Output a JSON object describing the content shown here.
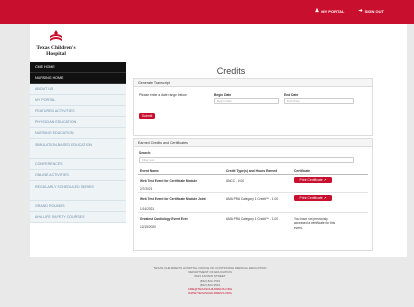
{
  "topbar": {
    "portal": "MY PORTAL",
    "signout": "SIGN OUT"
  },
  "logo": {
    "line1": "Texas Children's",
    "line2": "Hospital"
  },
  "sidebar": {
    "items": [
      {
        "label": "CME HOME",
        "style": "black"
      },
      {
        "label": "NURSING HOME",
        "style": "black"
      },
      {
        "label": "ABOUT US"
      },
      {
        "label": "MY PORTAL"
      },
      {
        "label": "FEATURED ACTIVITIES"
      },
      {
        "label": "PHYSICIAN EDUCATION"
      },
      {
        "label": "NURSING EDUCATION"
      },
      {
        "label": "SIMULATION-BASED EDUCATION",
        "style": "tall"
      },
      {
        "label": "CONFERENCES"
      },
      {
        "label": "ONLINE ACTIVITIES"
      },
      {
        "label": "REGULARLY SCHEDULED SERIES",
        "style": "tall"
      },
      {
        "label": "GRAND ROUNDS"
      },
      {
        "label": "AHA LIFE SAFETY COURSES"
      }
    ]
  },
  "main": {
    "title": "Credits",
    "generate": {
      "header": "Generate Transcript",
      "instructions": "Please enter a date range below:",
      "begin_label": "Begin Date",
      "begin_placeholder": "Begin Date",
      "end_label": "End Date",
      "end_placeholder": "End Date",
      "submit": "Submit"
    },
    "earned": {
      "header": "Earned Credits and Certificates",
      "search_label": "Search:",
      "search_placeholder": "Filter text",
      "columns": [
        "Event Name",
        "Credit Type(s) and Hours Earned",
        "Certificate"
      ],
      "rows": [
        {
          "name": "Web Test Event for Certificate Module",
          "date": "2/7/2021",
          "credit": "ANCC - 0.00",
          "cert": "Print Certificate"
        },
        {
          "name": "Web Test Event for Certificate Module Joint",
          "date": "1/14/2021",
          "credit": "AMA PRA Category 1 Credit™ - 1.00",
          "cert": "Print Certificate"
        },
        {
          "name": "Greatest Cardiology Event Ever",
          "date": "12/15/2020",
          "credit": "AMA PRA Category 1 Credit™ - 1.00",
          "cert": "You have not previously accessed a certificate for this event."
        }
      ]
    }
  },
  "footer": {
    "l1": "TEXAS CHILDREN'S HOSPITAL OFFICE OF CONTINUING MEDICAL EDUCATION",
    "l2": "DEPARTMENT OF EDUCATION",
    "l3": "6621 FANNIN STREET",
    "l4": "(832) 824-7501",
    "l5": "(832) 824-9591",
    "l6": "CME@TEXASCHILDRENS.ORG",
    "l7": "WWW.TEXASCHILDRENS.ORG"
  },
  "colors": {
    "brand_red": "#c8102e"
  }
}
